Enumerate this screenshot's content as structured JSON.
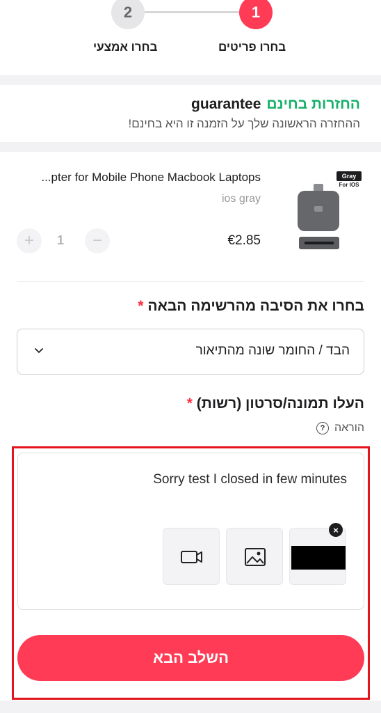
{
  "stepper": {
    "steps": [
      {
        "number": "1",
        "label": "בחרו פריטים",
        "active": true
      },
      {
        "number": "2",
        "label": "בחרו אמצעי",
        "active": false
      }
    ]
  },
  "guarantee": {
    "title_green": "החזרות בחינם",
    "title_black": "guarantee",
    "subtitle": "ההחזרה הראשונה שלך על הזמנה זו היא בחינם!"
  },
  "product": {
    "title": "...pter for Mobile Phone Macbook Laptops",
    "variant": "ios gray",
    "price": "€2.85",
    "quantity": "1",
    "image_tag": "Gray",
    "image_subtag": "For IOS"
  },
  "reason": {
    "label": "בחרו את הסיבה מהרשימה הבאה",
    "required_mark": "*",
    "selected": "הבד / החומר שונה מהתיאור"
  },
  "upload": {
    "label": "העלו תמונה/סרטון (רשות)",
    "required_mark": "*",
    "hint": "הוראה",
    "comment_text": "Sorry test I closed in few minutes"
  },
  "footer": {
    "next_button": "השלב הבא"
  },
  "colors": {
    "accent": "#ff3b55",
    "green": "#16b06a",
    "highlight_border": "#e3141c"
  },
  "icons": [
    "video-camera-icon",
    "image-icon",
    "remove-icon",
    "chevron-down-icon",
    "help-icon",
    "plus-icon",
    "minus-icon"
  ]
}
